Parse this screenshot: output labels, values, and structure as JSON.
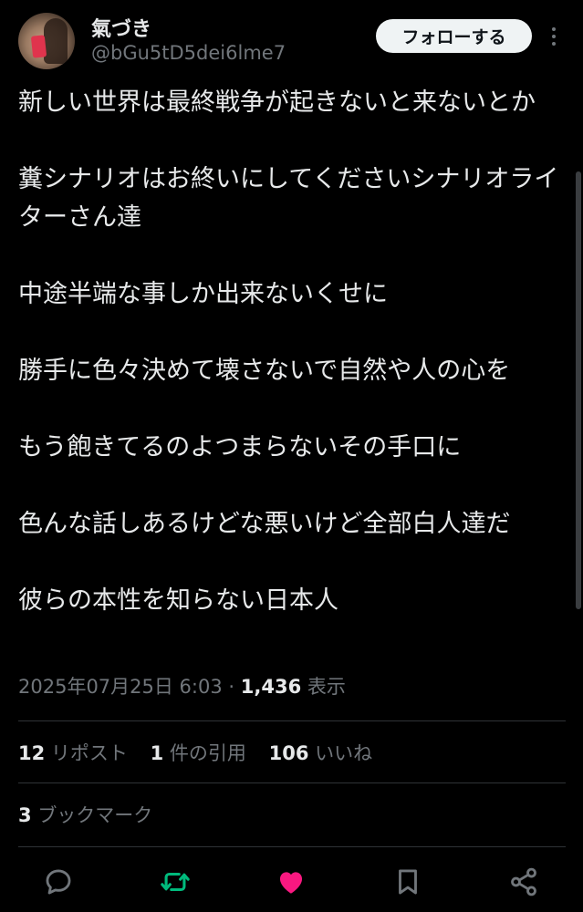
{
  "author": {
    "display_name": "氣づき",
    "handle": "@bGu5tD5dei6lme7"
  },
  "follow_button": {
    "label": "フォローする"
  },
  "tweet": {
    "paragraphs": [
      "新しい世界は最終戦争が起きないと来ないとか",
      "糞シナリオはお終いにしてくださいシナリオライターさん達",
      "中途半端な事しか出来ないくせに",
      "勝手に色々決めて壊さないで自然や人の心を",
      "もう飽きてるのよつまらないその手口に",
      "色んな話しあるけどな悪いけど全部白人達だ",
      "彼らの本性を知らない日本人"
    ]
  },
  "meta": {
    "timestamp": "2025年07月25日 6:03",
    "separator": "·",
    "views_count": "1,436",
    "views_label": "表示"
  },
  "stats": {
    "reposts_count": "12",
    "reposts_label": "リポスト",
    "quotes_count": "1",
    "quotes_label": "件の引用",
    "likes_count": "106",
    "likes_label": "いいね",
    "bookmarks_count": "3",
    "bookmarks_label": "ブックマーク"
  },
  "actions": [
    {
      "icon": "reply-icon",
      "color": "#71767b"
    },
    {
      "icon": "repost-icon",
      "color": "#00ba7c"
    },
    {
      "icon": "like-icon",
      "color": "#f91880"
    },
    {
      "icon": "bookmark-icon",
      "color": "#71767b"
    },
    {
      "icon": "share-icon",
      "color": "#71767b"
    }
  ],
  "colors": {
    "background": "#000000",
    "text": "#e7e9ea",
    "secondary_text": "#71767b",
    "repost_active": "#00ba7c",
    "like_active": "#f91880",
    "divider": "#2f3336"
  }
}
